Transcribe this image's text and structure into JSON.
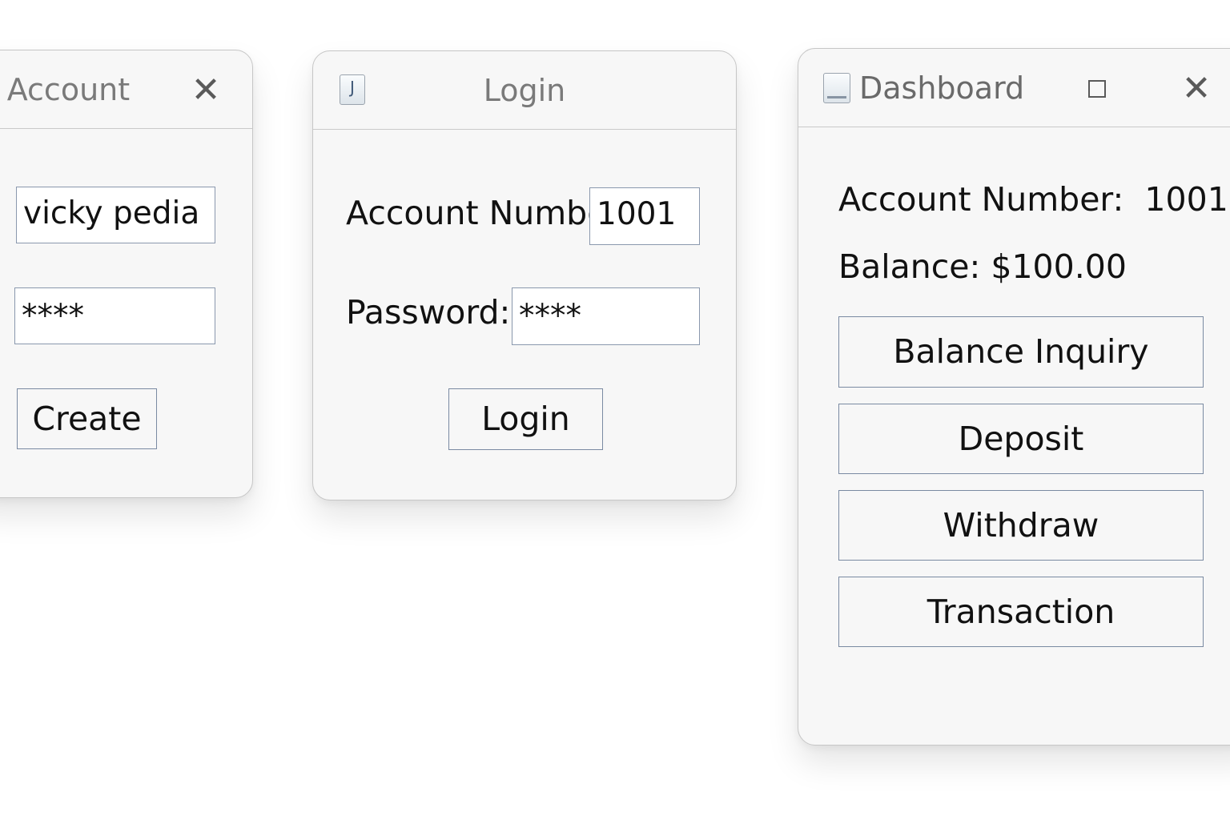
{
  "create_window": {
    "title": "r Account",
    "name_value": "vicky pedia",
    "password_value": "****",
    "create_label": "Create"
  },
  "login_window": {
    "title": "Login",
    "icon_glyph": "J",
    "account_label": "Account Number:",
    "account_value": "1001",
    "password_label": "Password:",
    "password_value": "****",
    "login_label": "Login"
  },
  "dashboard_window": {
    "title": "Dashboard",
    "account_text": "Account Number:  1001",
    "balance_text": "Balance: $100.00",
    "buttons": [
      "Balance Inquiry",
      "Deposit",
      "Withdraw",
      "Transaction"
    ]
  },
  "icons": {
    "close": "close-icon",
    "maximize": "maximize-icon",
    "app": "java-app-icon"
  }
}
